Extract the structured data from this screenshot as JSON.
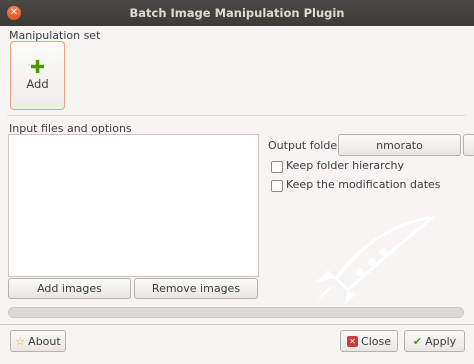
{
  "window": {
    "title": "Batch Image Manipulation Plugin"
  },
  "manipulation_set": {
    "label": "Manipulation set",
    "add_tile": {
      "icon": "plus-icon",
      "label": "Add",
      "accent": "#4e9a06"
    }
  },
  "input": {
    "label": "Input files and options",
    "add_images": "Add images",
    "remove_images": "Remove images"
  },
  "output": {
    "folder_label": "Output folder",
    "folder_value": "nmorato",
    "keep_hierarchy": {
      "label": "Keep folder hierarchy",
      "checked": false
    },
    "keep_dates": {
      "label": "Keep the modification dates",
      "checked": false
    }
  },
  "progress": {
    "value": 0
  },
  "footer": {
    "about": {
      "label": "About",
      "icon": "star-icon"
    },
    "close": {
      "label": "Close",
      "icon": "close-x-icon"
    },
    "apply": {
      "label": "Apply",
      "icon": "check-icon"
    }
  }
}
